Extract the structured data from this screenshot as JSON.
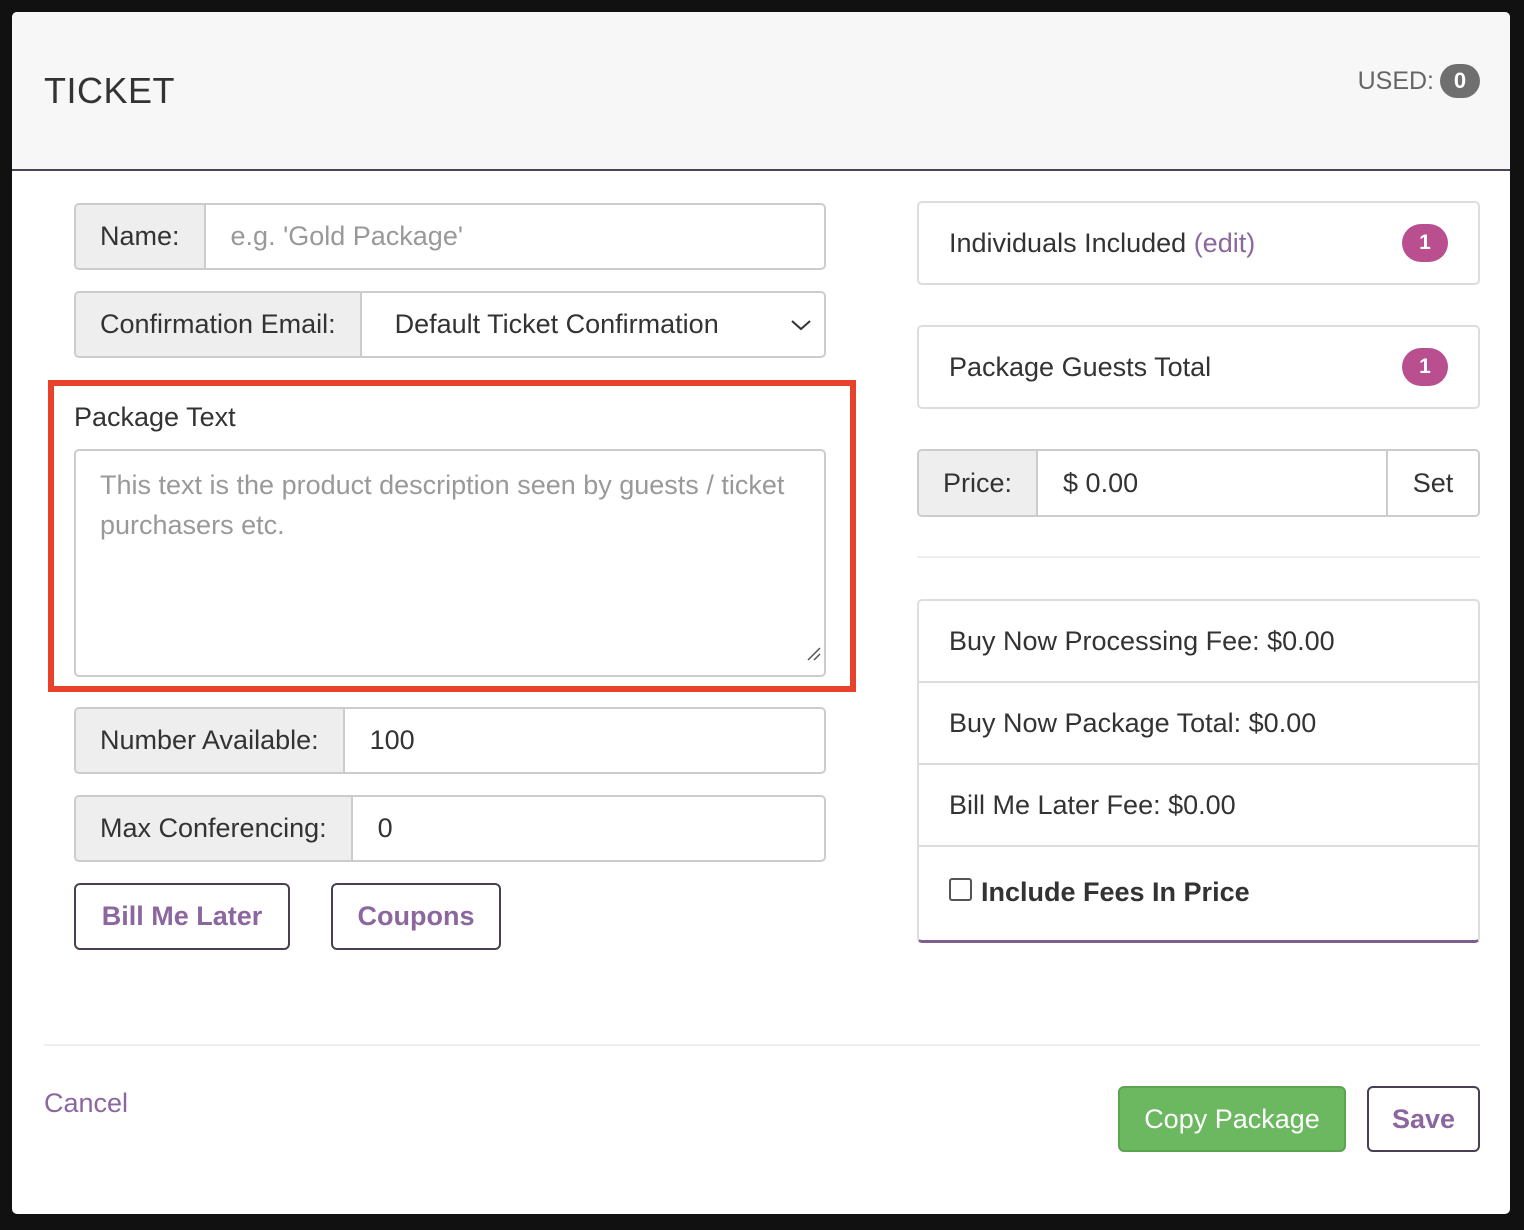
{
  "header": {
    "title": "TICKET",
    "used_label": "USED:",
    "used_count": "0"
  },
  "form": {
    "name": {
      "label": "Name:",
      "placeholder": "e.g. 'Gold Package'"
    },
    "confirmation_email": {
      "label": "Confirmation Email:",
      "value": "Default Ticket Confirmation"
    },
    "package_text": {
      "label": "Package Text",
      "placeholder": "This text is the product description seen by guests / ticket purchasers etc."
    },
    "number_available": {
      "label": "Number Available:",
      "value": "100"
    },
    "max_conferencing": {
      "label": "Max Conferencing:",
      "value": "0"
    },
    "bill_me_later_button": "Bill Me Later",
    "coupons_button": "Coupons"
  },
  "sidebar": {
    "individuals": {
      "label": "Individuals Included",
      "edit": "(edit)",
      "count": "1"
    },
    "guests_total": {
      "label": "Package Guests Total",
      "count": "1"
    },
    "price": {
      "label": "Price:",
      "value": "$ 0.00",
      "set_button": "Set"
    },
    "fees": [
      "Buy Now Processing Fee: $0.00",
      "Buy Now Package Total: $0.00",
      "Bill Me Later Fee: $0.00"
    ],
    "include_fees_label": "Include Fees In Price",
    "include_fees_checked": false
  },
  "footer": {
    "cancel": "Cancel",
    "copy_package": "Copy Package",
    "save": "Save"
  },
  "colors": {
    "accent": "#8c679f",
    "badge": "#b94f8f",
    "success": "#6cb860",
    "highlight": "#e8412c"
  }
}
